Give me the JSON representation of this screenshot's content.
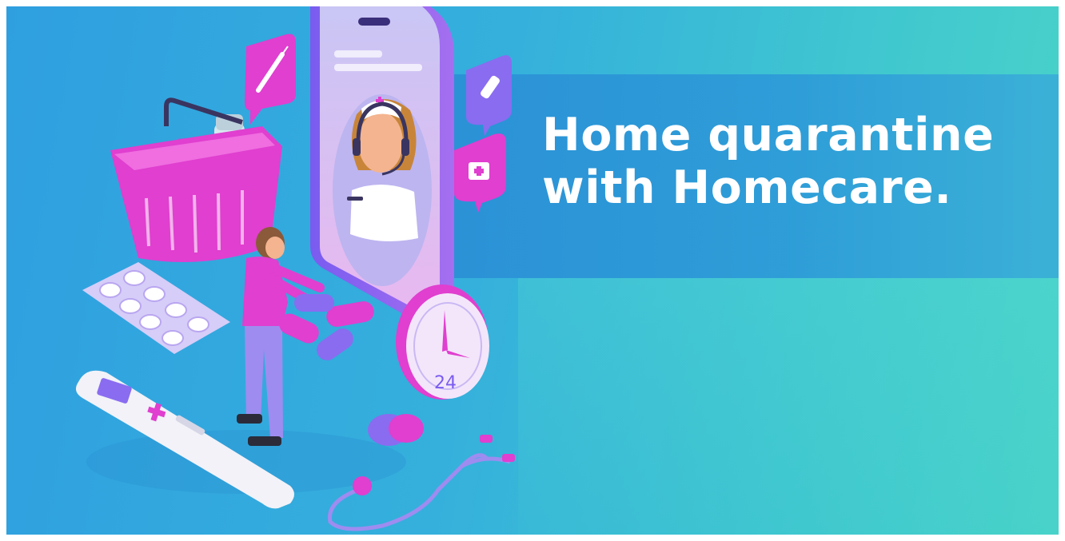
{
  "headline": {
    "line1": "Home quarantine",
    "line2": "with Homecare."
  },
  "clock": {
    "label": "24"
  },
  "colors": {
    "background": "#35b0dc",
    "banner": "#2d9ad8",
    "accent_magenta": "#e03fcf",
    "phone_purple": "#8a6cf0",
    "text": "#ffffff"
  },
  "icons": [
    "shopping-basket-icon",
    "syringe-icon",
    "bandage-icon",
    "medical-kit-icon",
    "clock-icon",
    "thermometer-icon",
    "stethoscope-icon",
    "pill-blister-icon",
    "nurse-avatar"
  ]
}
